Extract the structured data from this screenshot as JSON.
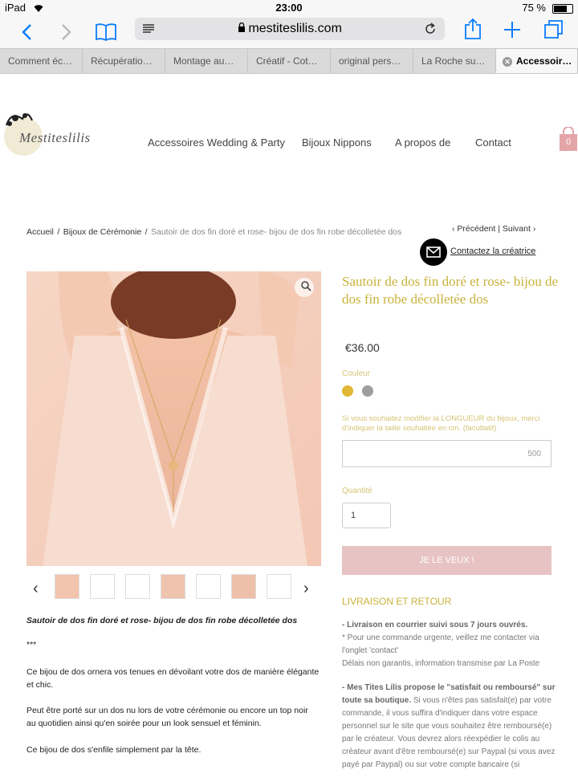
{
  "status": {
    "device": "iPad",
    "time": "23:00",
    "battery": "75 %"
  },
  "browser": {
    "url": "mestiteslilis.com",
    "tabs": [
      "Comment éc…",
      "Récupératio…",
      "Montage au…",
      "Créatif - Cot…",
      "original pers…",
      "La Roche su…",
      "Accessoir…"
    ]
  },
  "site": {
    "logo_text": "Mestiteslilis",
    "nav": [
      "Accessoires Wedding & Party",
      "Bijoux Nippons",
      "A propos de",
      "Contact"
    ],
    "cart_count": "0"
  },
  "breadcrumb": {
    "items": [
      "Accueil",
      "Bijoux de Cérémonie"
    ],
    "separator": "/",
    "current": "Sautoir de dos fin doré et rose- bijou de dos fin robe décolletée dos",
    "prev": "Précédent",
    "next": "Suivant",
    "nav_sep": "|"
  },
  "contact": {
    "label": "Contactez la créatrice"
  },
  "product": {
    "title": "Sautoir de dos fin doré et rose- bijou de dos fin robe décolletée dos",
    "price": "€36.00",
    "color_label": "Couleur",
    "colors": [
      "#e0b834",
      "#9e9e9e"
    ],
    "length_label": "Si vous souhaitez modifier la LONGUEUR du bijoux, merci d'indiquer la taille souhaitée en cm. (facultatif)",
    "length_value": "500",
    "qty_label": "Quantité",
    "qty_value": "1",
    "buy_label": "JE LE VEUX !"
  },
  "gallery": {
    "thumb_count": 7
  },
  "description": {
    "title": "Sautoir de dos fin doré et rose- bijou de dos fin robe décolletée dos",
    "stars": "***",
    "p1": "Ce bijou de dos ornera vos tenues en dévoilant votre dos de manière élégante et chic.",
    "p2": "Peut être porté sur un dos nu lors de votre cérémonie ou encore un top noir au quotidien ainsi qu'en soirée pour un look sensuel et féminin.",
    "p3": "Ce bijou de dos s'enfile simplement par la tête."
  },
  "shipping": {
    "heading": "LIVRAISON ET RETOUR",
    "l1_bold": "- Livraison en courrier suivi sous 7 jours ouvrés.",
    "l2": "* Pour une commande urgente, veillez me contacter via l'onglet 'contact'",
    "l3": "Délais non garantis, information transmise par La Poste",
    "l4_bold": "- Mes Tites Lilis propose le \"satisfait ou remboursé\" sur toute sa boutique.",
    "l4_rest": " Si vous n'êtes pas satisfait(e) par votre commande, il vous suffira d'indiquer dans votre espace personnel sur le site que vous souhaitez être remboursé(e) par le créateur. Vous devrez alors réexpédier le colis au créateur avant d'être remboursé(e) sur Paypal (si vous avez payé par Paypal) ou sur votre compte bancaire (si"
  }
}
